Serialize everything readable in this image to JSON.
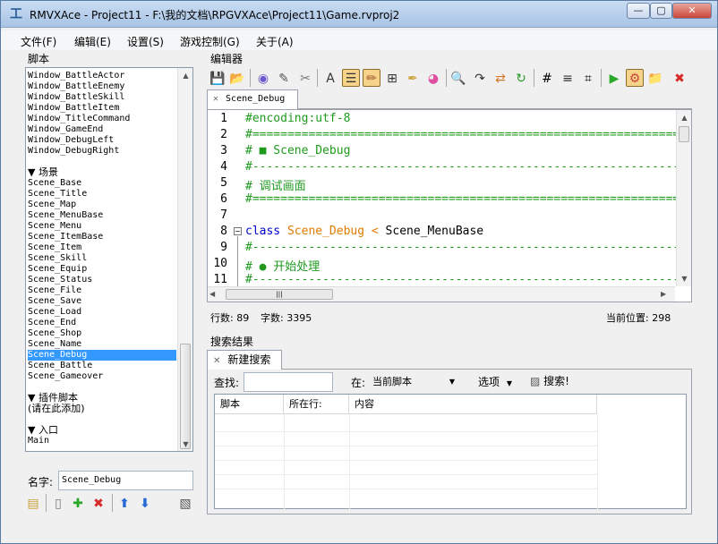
{
  "window": {
    "title": "RMVXAce - Project11 - F:\\我的文档\\RPGVXAce\\Project11\\Game.rvproj2",
    "app_icon": "rpg-maker-icon"
  },
  "menu": [
    "文件(F)",
    "编辑(E)",
    "设置(S)",
    "游戏控制(G)",
    "关于(A)"
  ],
  "scripts_panel": {
    "label": "脚本",
    "items": [
      "Window_BattleActor",
      "Window_BattleEnemy",
      "Window_BattleSkill",
      "Window_BattleItem",
      "Window_TitleCommand",
      "Window_GameEnd",
      "Window_DebugLeft",
      "Window_DebugRight",
      "",
      "▼ 场景",
      "Scene_Base",
      "Scene_Title",
      "Scene_Map",
      "Scene_MenuBase",
      "Scene_Menu",
      "Scene_ItemBase",
      "Scene_Item",
      "Scene_Skill",
      "Scene_Equip",
      "Scene_Status",
      "Scene_File",
      "Scene_Save",
      "Scene_Load",
      "Scene_End",
      "Scene_Shop",
      "Scene_Name",
      "Scene_Debug",
      "Scene_Battle",
      "Scene_Gameover",
      "",
      "▼ 插件脚本",
      "(请在此添加)",
      "",
      "▼ 入口",
      "Main"
    ],
    "selected_index": 26,
    "name_label": "名字:",
    "name_value": "Scene_Debug"
  },
  "editor": {
    "label": "编辑器",
    "tab": "Scene_Debug",
    "lines": [
      {
        "n": "1",
        "t": "#encoding:utf-8"
      },
      {
        "n": "2",
        "t": "#=================================================================="
      },
      {
        "n": "3",
        "t": "# ■ Scene_Debug"
      },
      {
        "n": "4",
        "t": "#------------------------------------------------------------------"
      },
      {
        "n": "5",
        "t": "#   调试画面"
      },
      {
        "n": "6",
        "t": "#=================================================================="
      },
      {
        "n": "7",
        "t": ""
      },
      {
        "n": "8",
        "kw": "class ",
        "cls": "Scene_Debug",
        "op": " < ",
        "rest": "Scene_MenuBase"
      },
      {
        "n": "9",
        "t": "  #--------------------------------------------------------------"
      },
      {
        "n": "10",
        "t": "  # ● 开始处理"
      },
      {
        "n": "11",
        "t": "  #--------------------------------------------------------------"
      }
    ],
    "status_lines": "行数: 89",
    "status_chars": "字数: 3395",
    "status_pos": "当前位置: 298"
  },
  "search": {
    "label": "搜索结果",
    "tab": "新建搜索",
    "find_label": "查找:",
    "in_label": "在:",
    "scope_value": "当前脚本",
    "options_label": "选项",
    "search_button": "搜索!",
    "columns": [
      "脚本",
      "所在行:",
      "内容"
    ]
  },
  "toolbar_icons": [
    "save-icon",
    "open-folder-icon",
    "preview-icon",
    "edit-icon",
    "tools-icon",
    "font-size-icon",
    "indent-icon",
    "pencil-icon",
    "grid-icon",
    "highlighter-icon",
    "color-wheel-icon",
    "search-icon",
    "goto-icon",
    "replace-icon",
    "refresh-icon",
    "hash-icon",
    "list-icon",
    "crop-icon",
    "run-icon",
    "settings-icon",
    "folder-icon",
    "close-icon"
  ],
  "script_toolbar_icons": [
    "import-icon",
    "new-icon",
    "add-icon",
    "delete-icon",
    "move-up-icon",
    "move-down-icon",
    "export-icon"
  ]
}
